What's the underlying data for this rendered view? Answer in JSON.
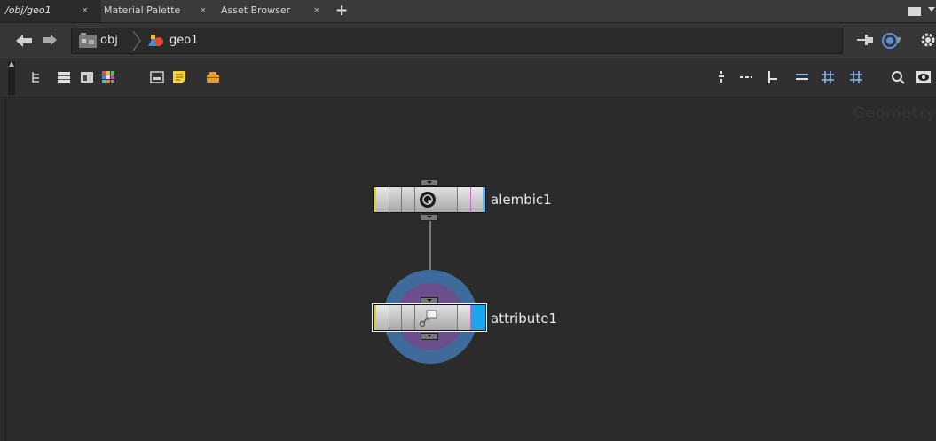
{
  "tabs": [
    {
      "label": "/obj/geo1",
      "active": true
    },
    {
      "label": "Material Palette",
      "active": false
    },
    {
      "label": "Asset Browser",
      "active": false
    }
  ],
  "tab_close_glyph": "×",
  "add_tab_glyph": "+",
  "path": {
    "root": "obj",
    "current": "geo1"
  },
  "context_watermark": "Geometry",
  "nodes": [
    {
      "name": "alembic1",
      "icon": "alembic-icon"
    },
    {
      "name": "attribute1",
      "icon": "attribute-icon",
      "selected": true
    }
  ],
  "colors": {
    "accent_blue": "#1aa7ec",
    "selection_ring": "#4a6a9a",
    "purple_ring": "#6a4a8a"
  }
}
